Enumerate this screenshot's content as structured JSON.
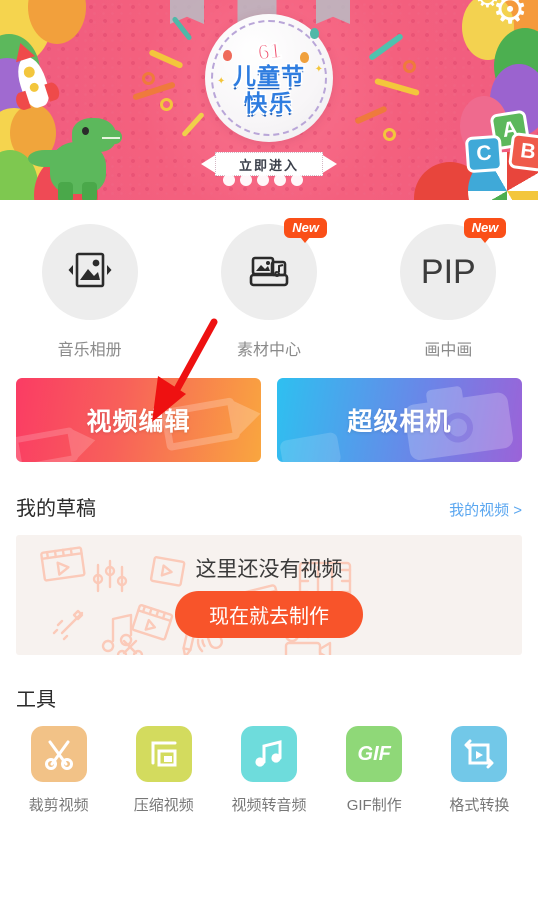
{
  "banner": {
    "badge_number": "61",
    "badge_line1": "儿童节",
    "badge_line2": "快乐",
    "cta_label": "立即进入",
    "colors": {
      "bg_pink": "#f4607e",
      "badge_blue": "#2f7de0",
      "badge_red": "#ef4a6a"
    }
  },
  "features": [
    {
      "label": "音乐相册",
      "icon": "music-album-icon",
      "badge": ""
    },
    {
      "label": "素材中心",
      "icon": "material-center-icon",
      "badge": "New"
    },
    {
      "label": "画中画",
      "icon": "PIP",
      "badge": "New"
    }
  ],
  "main_cards": [
    {
      "label": "视频编辑",
      "icon": "video-camera-icon",
      "accent": "#fa3c64"
    },
    {
      "label": "超级相机",
      "icon": "camera-icon",
      "accent": "#2ec0f0"
    }
  ],
  "drafts": {
    "title": "我的草稿",
    "link": "我的视频 >",
    "empty_text": "这里还没有视频",
    "button_label": "现在就去制作",
    "button_color": "#f8542a"
  },
  "tools": {
    "title": "工具",
    "items": [
      {
        "label": "裁剪视频",
        "icon": "scissors-icon",
        "color": "#f2c287"
      },
      {
        "label": "压缩视频",
        "icon": "compress-icon",
        "color": "#d3db5e"
      },
      {
        "label": "视频转音频",
        "icon": "music-note-icon",
        "color": "#6edcdc"
      },
      {
        "label": "GIF制作",
        "icon": "gif-icon",
        "color": "#8fd878"
      },
      {
        "label": "格式转换",
        "icon": "format-convert-icon",
        "color": "#72c8e8"
      }
    ]
  },
  "annotation": {
    "arrow": "red-arrow-pointing-to-video-edit",
    "color": "#ee1111"
  }
}
